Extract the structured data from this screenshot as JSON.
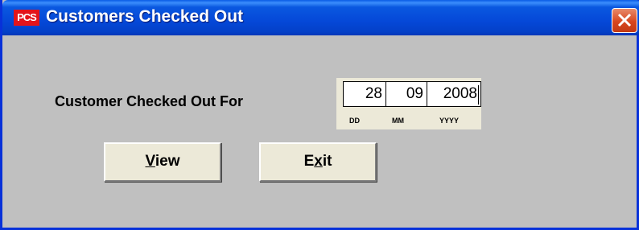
{
  "window": {
    "title": "Customers Checked Out",
    "app_icon_text": "PCS"
  },
  "form": {
    "label": "Customer Checked Out For",
    "date": {
      "day": "28",
      "month": "09",
      "year": "2008",
      "day_hint": "DD",
      "month_hint": "MM",
      "year_hint": "YYYY"
    }
  },
  "buttons": {
    "view": {
      "prefix": "",
      "mnemonic": "V",
      "suffix": "iew"
    },
    "exit": {
      "prefix": "E",
      "mnemonic": "x",
      "suffix": "it"
    }
  },
  "colors": {
    "titlebar": "#0548d8",
    "close_button": "#d8471f",
    "app_icon": "#e3141b",
    "window_bg": "#c0c0c0"
  }
}
